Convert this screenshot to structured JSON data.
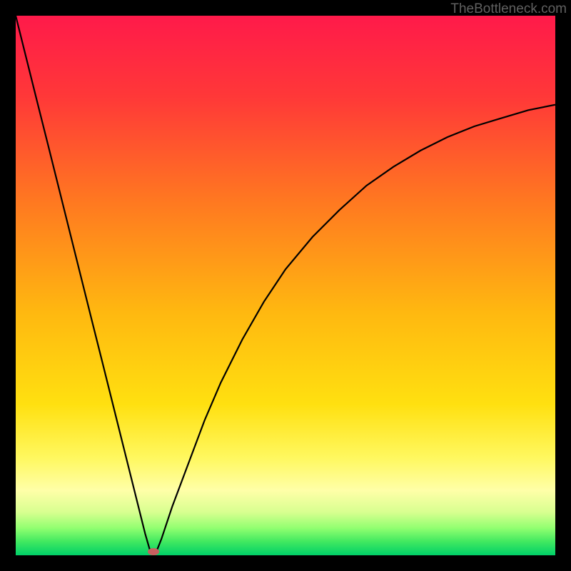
{
  "watermark": "TheBottleneck.com",
  "chart_data": {
    "type": "line",
    "title": "",
    "xlabel": "",
    "ylabel": "",
    "xlim": [
      0,
      100
    ],
    "ylim": [
      0,
      100
    ],
    "curve_points": [
      {
        "x": 0,
        "y": 100
      },
      {
        "x": 2,
        "y": 92
      },
      {
        "x": 4,
        "y": 84
      },
      {
        "x": 6,
        "y": 76
      },
      {
        "x": 8,
        "y": 68
      },
      {
        "x": 10,
        "y": 60
      },
      {
        "x": 12,
        "y": 52
      },
      {
        "x": 14,
        "y": 44
      },
      {
        "x": 16,
        "y": 36
      },
      {
        "x": 18,
        "y": 28
      },
      {
        "x": 20,
        "y": 20
      },
      {
        "x": 22,
        "y": 12
      },
      {
        "x": 24,
        "y": 4
      },
      {
        "x": 25,
        "y": 0.5
      },
      {
        "x": 26,
        "y": 0.5
      },
      {
        "x": 27,
        "y": 3
      },
      {
        "x": 29,
        "y": 9
      },
      {
        "x": 32,
        "y": 17
      },
      {
        "x": 35,
        "y": 25
      },
      {
        "x": 38,
        "y": 32
      },
      {
        "x": 42,
        "y": 40
      },
      {
        "x": 46,
        "y": 47
      },
      {
        "x": 50,
        "y": 53
      },
      {
        "x": 55,
        "y": 59
      },
      {
        "x": 60,
        "y": 64
      },
      {
        "x": 65,
        "y": 68.5
      },
      {
        "x": 70,
        "y": 72
      },
      {
        "x": 75,
        "y": 75
      },
      {
        "x": 80,
        "y": 77.5
      },
      {
        "x": 85,
        "y": 79.5
      },
      {
        "x": 90,
        "y": 81
      },
      {
        "x": 95,
        "y": 82.5
      },
      {
        "x": 100,
        "y": 83.5
      }
    ],
    "marker_position": {
      "x": 25.5,
      "y": 0.7
    },
    "gradient_stops": [
      {
        "offset": 0,
        "color": "#ff1a4a"
      },
      {
        "offset": 15,
        "color": "#ff3838"
      },
      {
        "offset": 35,
        "color": "#ff7a20"
      },
      {
        "offset": 55,
        "color": "#ffb810"
      },
      {
        "offset": 72,
        "color": "#ffe010"
      },
      {
        "offset": 82,
        "color": "#fff860"
      },
      {
        "offset": 88,
        "color": "#ffffa8"
      },
      {
        "offset": 92,
        "color": "#d8ff90"
      },
      {
        "offset": 95,
        "color": "#90ff70"
      },
      {
        "offset": 97.5,
        "color": "#40e860"
      },
      {
        "offset": 100,
        "color": "#00d068"
      }
    ]
  }
}
